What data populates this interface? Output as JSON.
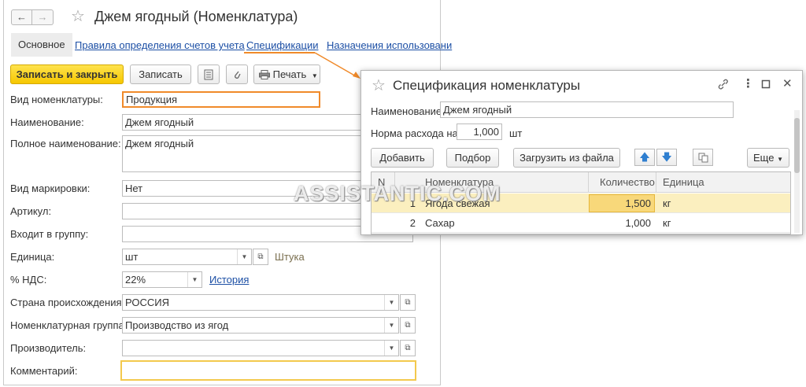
{
  "main": {
    "nav": {
      "back": "←",
      "forward": "→"
    },
    "title": "Джем ягодный (Номенклатура)",
    "tabs": {
      "active": "Основное",
      "links": [
        "Правила определения счетов учета",
        "Спецификации",
        "Назначения использовани"
      ]
    },
    "toolbar": {
      "save_close": "Записать и закрыть",
      "save": "Записать",
      "print": "Печать"
    },
    "fields": {
      "kind_label": "Вид номенклатуры:",
      "kind_value": "Продукция",
      "name_label": "Наименование:",
      "name_value": "Джем ягодный",
      "full_name_label": "Полное наименование:",
      "full_name_value": "Джем ягодный",
      "marking_label": "Вид маркировки:",
      "marking_value": "Нет",
      "article_label": "Артикул:",
      "article_value": "",
      "group_label": "Входит в группу:",
      "group_value": "",
      "unit_label": "Единица:",
      "unit_value": "шт",
      "unit_full": "Штука",
      "vat_label": "% НДС:",
      "vat_value": "22%",
      "vat_history": "История",
      "country_label": "Страна происхождения:",
      "country_value": "РОССИЯ",
      "nomgroup_label": "Номенклатурная группа:",
      "nomgroup_value": "Производство из ягод",
      "maker_label": "Производитель:",
      "maker_value": "",
      "comment_label": "Комментарий:",
      "comment_value": ""
    }
  },
  "dialog": {
    "title": "Спецификация номенклатуры",
    "name_label": "Наименование:",
    "name_value": "Джем ягодный",
    "norm_label": "Норма расхода на",
    "norm_value": "1,000",
    "norm_unit": "шт",
    "buttons": {
      "add": "Добавить",
      "pick": "Подбор",
      "load": "Загрузить из файла",
      "more": "Еще"
    },
    "table": {
      "columns": [
        "N",
        "Номенклатура",
        "Количество",
        "Единица"
      ],
      "rows": [
        {
          "n": "1",
          "item": "Ягода свежая",
          "qty": "1,500",
          "unit": "кг"
        },
        {
          "n": "2",
          "item": "Сахар",
          "qty": "1,000",
          "unit": "кг"
        }
      ]
    }
  },
  "watermark": "ASSISTANTIC.COM",
  "colors": {
    "accent_yellow": "#f6c700",
    "link_blue": "#1c4fa5",
    "highlight_orange": "#f08a2a",
    "selected_row": "#fbefbf"
  }
}
